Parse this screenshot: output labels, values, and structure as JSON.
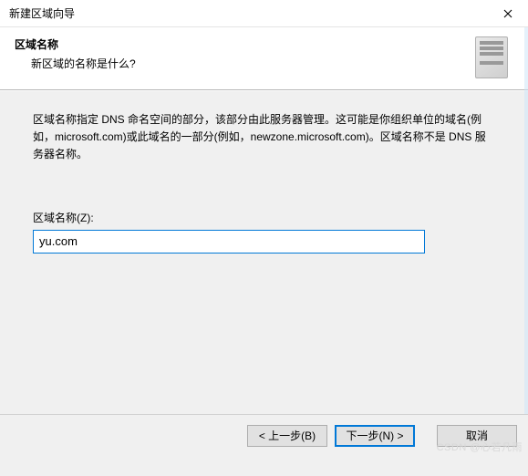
{
  "titlebar": {
    "title": "新建区域向导"
  },
  "header": {
    "title": "区域名称",
    "subtitle": "新区域的名称是什么?"
  },
  "content": {
    "description": "区域名称指定 DNS 命名空间的部分，该部分由此服务器管理。这可能是你组织单位的域名(例如，microsoft.com)或此域名的一部分(例如，newzone.microsoft.com)。区域名称不是 DNS 服务器名称。",
    "field_label": "区域名称(Z):",
    "field_value": "yu.com"
  },
  "buttons": {
    "back": "< 上一步(B)",
    "next": "下一步(N) >",
    "cancel": "取消"
  },
  "watermark": "CSDN @心若凡雨"
}
